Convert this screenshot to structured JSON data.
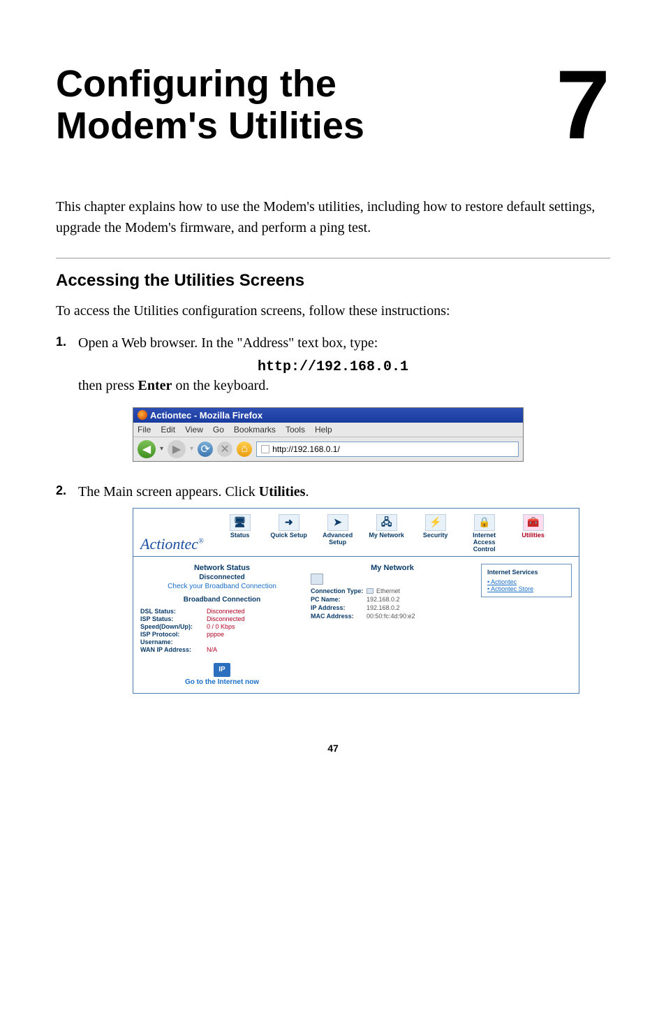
{
  "title_line1": "Configuring the",
  "title_line2": "Modem's Utilities",
  "chapter_number": "7",
  "intro": "This chapter explains how to use the Modem's utilities, including how to restore default settings, upgrade the Modem's firmware, and perform a ping test.",
  "section_heading": "Accessing the Utilities Screens",
  "section_intro": "To access the Utilities configuration screens, follow these instructions:",
  "step1": {
    "num": "1.",
    "text_before": "Open a Web browser. In the \"Address\" text box, type:",
    "code": "http://192.168.0.1",
    "text_after_prefix": "then press ",
    "text_after_bold": "Enter",
    "text_after_suffix": " on the keyboard."
  },
  "step2": {
    "num": "2.",
    "text_prefix": "The Main screen appears. Click ",
    "text_bold": "Utilities",
    "text_suffix": "."
  },
  "browser": {
    "title": "Actiontec - Mozilla Firefox",
    "menus": {
      "file": "File",
      "edit": "Edit",
      "view": "View",
      "go": "Go",
      "bookmarks": "Bookmarks",
      "tools": "Tools",
      "help": "Help"
    },
    "url": "http://192.168.0.1/"
  },
  "router": {
    "brand": "Actiontec",
    "brand_suffix": "®",
    "tabs": {
      "status": "Status",
      "quick_setup": "Quick Setup",
      "advanced_setup": "Advanced Setup",
      "my_network": "My Network",
      "security": "Security",
      "internet_access": "Internet Access Control",
      "utilities": "Utilities"
    },
    "left": {
      "network_status_title": "Network Status",
      "disconnected": "Disconnected",
      "check_conn": "Check your Broadband Connection",
      "broadband_conn": "Broadband Connection",
      "dsl_status_k": "DSL Status:",
      "dsl_status_v": "Disconnected",
      "isp_status_k": "ISP Status:",
      "isp_status_v": "Disconnected",
      "speed_k": "Speed(Down/Up):",
      "speed_v": "0 / 0 Kbps",
      "isp_proto_k": "ISP Protocol:",
      "isp_proto_v": "pppoe",
      "username_k": "Username:",
      "wan_ip_k": "WAN IP Address:",
      "wan_ip_v": "N/A",
      "go_internet": "Go to the Internet now",
      "ip_badge": "IP"
    },
    "mid": {
      "my_network": "My Network",
      "conn_type_k": "Connection Type:",
      "conn_type_v": "Ethernet",
      "pc_name_k": "PC Name:",
      "pc_name_v": "192.168.0.2",
      "ip_addr_k": "IP Address:",
      "ip_addr_v": "192.168.0.2",
      "mac_k": "MAC Address:",
      "mac_v": "00:50:fc:4d:90:e2"
    },
    "right": {
      "title": "Internet Services",
      "link1": "Actiontec",
      "link2": "Actiontec Store"
    }
  },
  "page_number": "47"
}
